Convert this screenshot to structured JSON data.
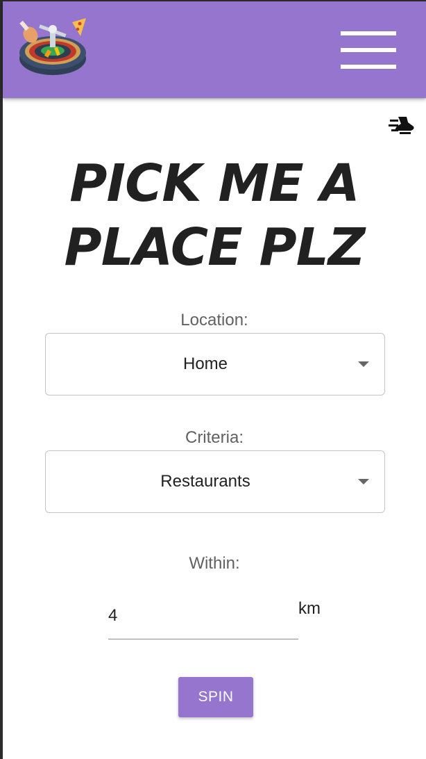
{
  "header": {
    "logo_icon": "roulette-food-logo-icon",
    "menu_icon": "hamburger-menu-icon",
    "background_color": "#9575cd"
  },
  "toolbar": {
    "speed_icon": "fast-forward-icon"
  },
  "main": {
    "title_line1": "PICK ME A",
    "title_line2": "PLACE PLZ",
    "location": {
      "label": "Location:",
      "selected": "Home"
    },
    "criteria": {
      "label": "Criteria:",
      "selected": "Restaurants"
    },
    "within": {
      "label": "Within:",
      "value": "4",
      "unit": "km"
    },
    "spin_label": "SPIN"
  },
  "colors": {
    "accent": "#9575cd",
    "title": "#212121"
  }
}
